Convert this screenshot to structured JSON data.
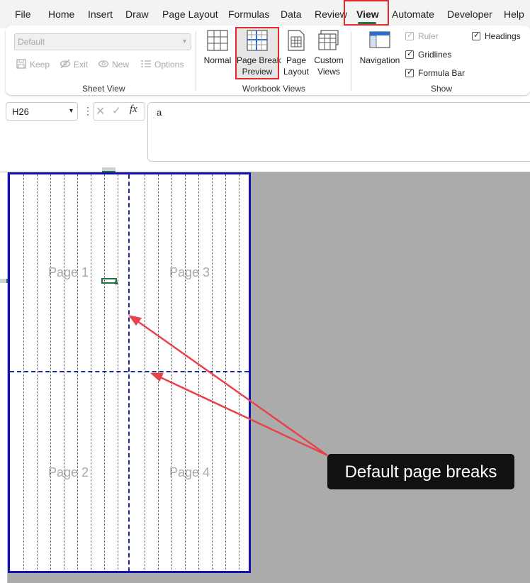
{
  "menu": {
    "tabs": [
      {
        "label": "File"
      },
      {
        "label": "Home"
      },
      {
        "label": "Insert"
      },
      {
        "label": "Draw"
      },
      {
        "label": "Page Layout"
      },
      {
        "label": "Formulas"
      },
      {
        "label": "Data"
      },
      {
        "label": "Review"
      },
      {
        "label": "View"
      },
      {
        "label": "Automate"
      },
      {
        "label": "Developer"
      },
      {
        "label": "Help"
      }
    ],
    "active_tab": "View"
  },
  "ribbon": {
    "sheet_view": {
      "group_label": "Sheet View",
      "selected_view": "Default",
      "keep_label": "Keep",
      "exit_label": "Exit",
      "new_label": "New",
      "options_label": "Options"
    },
    "workbook_views": {
      "group_label": "Workbook Views",
      "normal_label": "Normal",
      "page_break_line1": "Page Break",
      "page_break_line2": "Preview",
      "page_layout_line1": "Page",
      "page_layout_line2": "Layout",
      "custom_views_line1": "Custom",
      "custom_views_line2": "Views"
    },
    "show": {
      "group_label": "Show",
      "navigation_label": "Navigation",
      "ruler_label": "Ruler",
      "ruler_checked": true,
      "gridlines_label": "Gridlines",
      "gridlines_checked": true,
      "formula_bar_label": "Formula Bar",
      "formula_bar_checked": true,
      "headings_label": "Headings",
      "headings_checked": true
    }
  },
  "formula_bar": {
    "name_box": "H26",
    "fx_label": "fx",
    "content": "a"
  },
  "sheet": {
    "pages": [
      {
        "label": "Page 1"
      },
      {
        "label": "Page 2"
      },
      {
        "label": "Page 3"
      },
      {
        "label": "Page 4"
      }
    ],
    "callout": "Default page breaks",
    "colors": {
      "page_border": "#1212b4",
      "page_break": "#1a2a9a",
      "highlight_red": "#e8262d",
      "active_green": "#217346",
      "callout_bg": "#111111",
      "annotation_arrow": "#e8434a"
    }
  }
}
